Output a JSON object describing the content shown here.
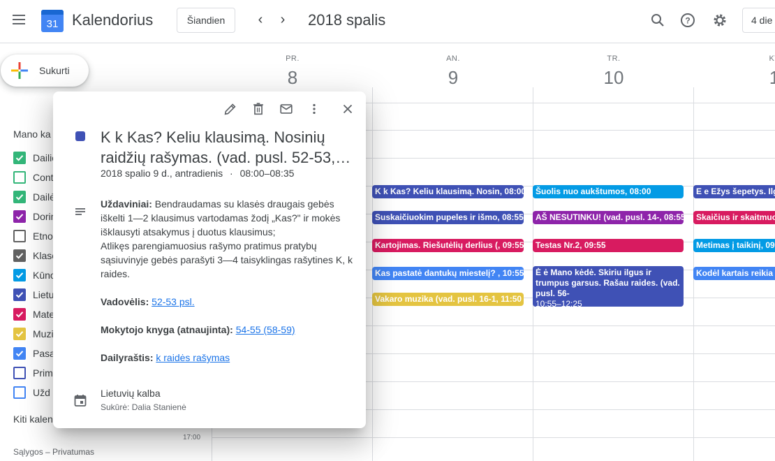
{
  "header": {
    "app_title": "Kalendorius",
    "logo_number": "31",
    "today_label": "Šiandien",
    "period_label": "2018 spalis",
    "view_label": "4 die"
  },
  "create": {
    "label": "Sukurti"
  },
  "sidebar": {
    "my_calendars_title": "Mano ka",
    "other_calendars_title": "Kiti kalen",
    "footer": "Sąlygos – Privatumas",
    "calendars": [
      {
        "label": "Dailio",
        "checked": true,
        "color": "#33b679"
      },
      {
        "label": "Conti",
        "checked": false,
        "color": "#33b679"
      },
      {
        "label": "Dailė",
        "checked": true,
        "color": "#33b679"
      },
      {
        "label": "Dorin",
        "checked": true,
        "color": "#8e24aa"
      },
      {
        "label": "Etno",
        "checked": false,
        "color": "#616161"
      },
      {
        "label": "Klasė",
        "checked": true,
        "color": "#616161"
      },
      {
        "label": "Kūno",
        "checked": true,
        "color": "#039be5"
      },
      {
        "label": "Lietu",
        "checked": true,
        "color": "#3f51b5"
      },
      {
        "label": "Mate",
        "checked": true,
        "color": "#d81b60"
      },
      {
        "label": "Muzi",
        "checked": true,
        "color": "#e4c441"
      },
      {
        "label": "Pasa",
        "checked": true,
        "color": "#4285f4"
      },
      {
        "label": "Prim",
        "checked": false,
        "color": "#3f51b5"
      },
      {
        "label": "Užd",
        "checked": false,
        "color": "#4285f4"
      }
    ]
  },
  "days": [
    {
      "dow": "PR.",
      "num": "8"
    },
    {
      "dow": "AN.",
      "num": "9"
    },
    {
      "dow": "TR.",
      "num": "10"
    },
    {
      "dow": "KT",
      "num": "1"
    }
  ],
  "time_label": "17:00",
  "events": {
    "tue": [
      {
        "title": "K k Kas? Keliu klausimą. Nosin, 08:00",
        "color": "#3f51b5"
      },
      {
        "title": "Suskaičiuokim pupeles ir išmo, 08:55",
        "color": "#3f51b5"
      },
      {
        "title": "Kartojimas. Riešutėlių derlius (, 09:55",
        "color": "#d81b60"
      },
      {
        "title": "Kas pastatė dantukų miestelį? , 10:55",
        "color": "#4285f4"
      },
      {
        "title": "Vakaro muzika (vad. pusl. 16-1, 11:50",
        "color": "#e4c441"
      }
    ],
    "wed": [
      {
        "title": "Šuolis nuo aukštumos, 08:00",
        "color": "#039be5"
      },
      {
        "title": "AŠ NESUTINKU! (vad. pusl. 14-, 08:55",
        "color": "#8e24aa"
      },
      {
        "title": "Testas Nr.2, 09:55",
        "color": "#d81b60"
      },
      {
        "title": "Ė ė Mano kėdė. Skiriu ilgus ir trumpus garsus. Rašau raides. (vad. pusl. 56-",
        "time": "10:55–12:25",
        "color": "#3f51b5"
      }
    ],
    "thu": [
      {
        "title": "E e Ežys šepetys. Ilgi",
        "color": "#3f51b5"
      },
      {
        "title": "Skaičius ir skaitmuo",
        "color": "#d81b60"
      },
      {
        "title": "Metimas į taikinį, 09:",
        "color": "#039be5"
      },
      {
        "title": "Kodėl kartais reikia p",
        "color": "#4285f4"
      }
    ]
  },
  "popup": {
    "title_line1": "K k Kas? Keliu klausimą. Nosinių",
    "title_line2": "raidžių rašymas. (vad. pusl. 52-53,…",
    "date": "2018 spalio 9 d., antradienis",
    "time": "08:00–08:35",
    "date_separator": "·",
    "color": "#3f51b5",
    "desc_goals_label": "Uždaviniai:",
    "desc_goals_text1": " Bendraudamas su klasės draugais gebės iškelti 1—2 klausimus vartodamas žodį „Kas?\" ir mokės išklausyti atsakymus į duotus klausimus;",
    "desc_goals_text2": "Atlikęs parengiamuosius rašymo pratimus pratybų sąsiuvinyje gebės parašyti 3—4 taisyklingas rašytines K, k raides.",
    "textbook_label": "Vadovėlis:",
    "textbook_link": "52-53 psl.",
    "teacher_book_label": "Mokytojo knyga (atnaujinta):",
    "teacher_book_link": "54-55 (58-59)",
    "writing_label": "Dailyraštis:",
    "writing_link": "k raidės rašymas",
    "calendar_name": "Lietuvių kalba",
    "creator": "Sukūrė: Dalia Stanienė"
  }
}
